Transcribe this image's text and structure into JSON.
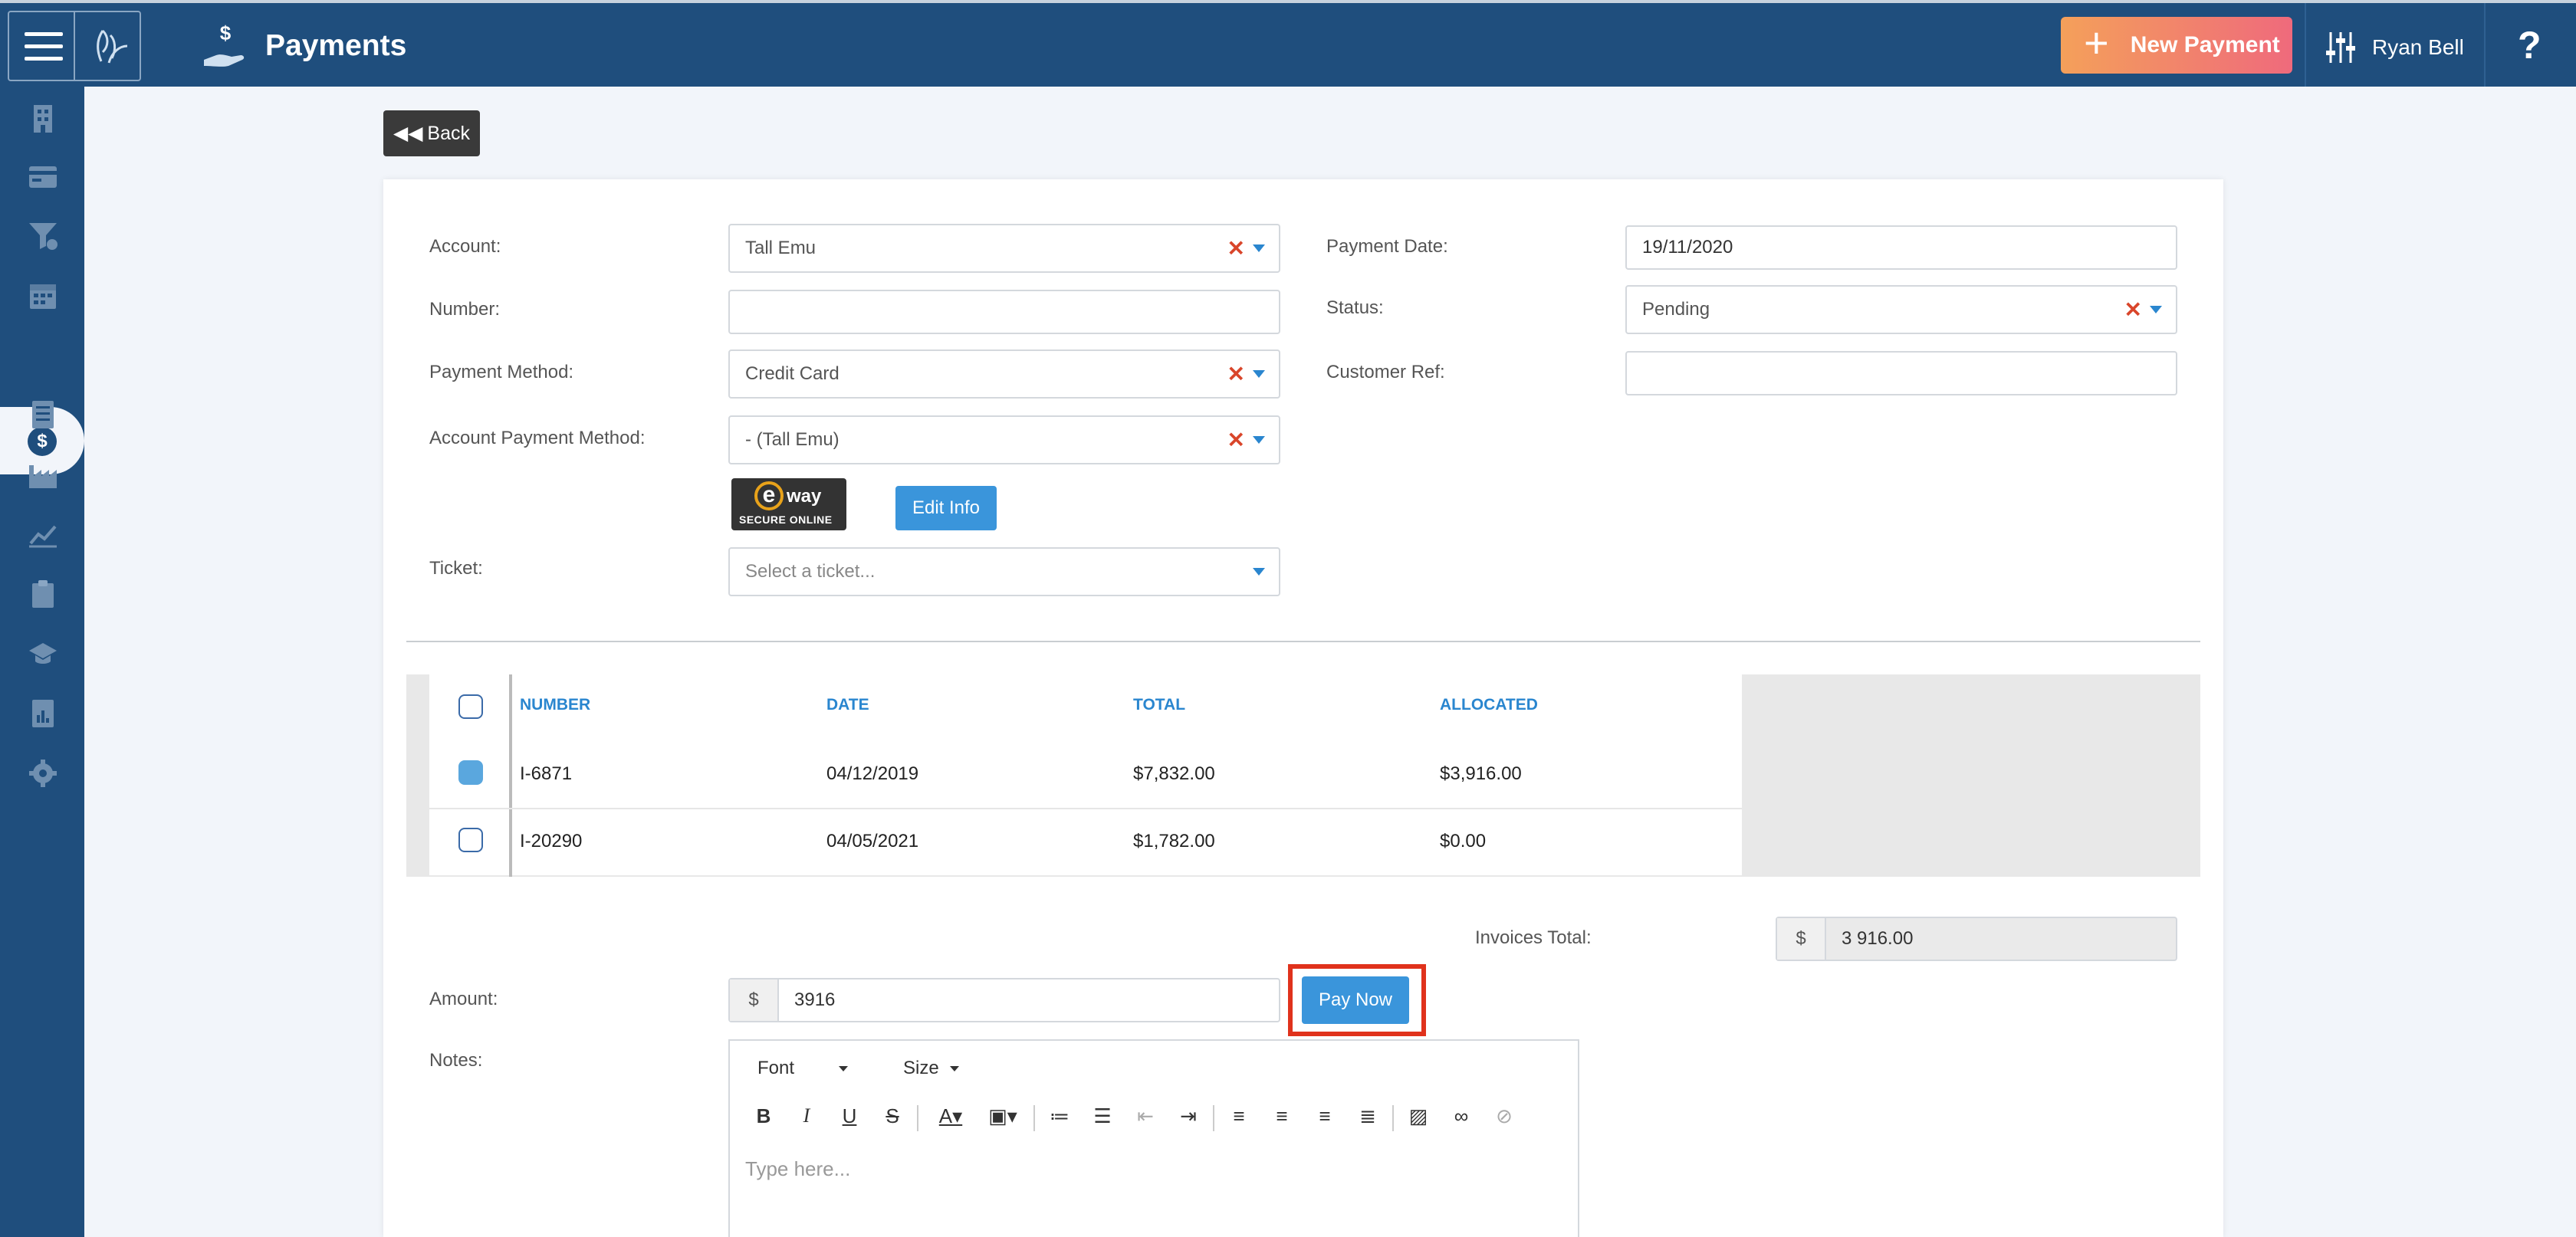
{
  "topbar": {
    "title": "Payments",
    "new_payment_label": "New Payment",
    "user_name": "Ryan Bell",
    "help_label": "?"
  },
  "sidebar": {
    "icons": [
      "building-icon",
      "card-icon",
      "funnel-icon",
      "calendar-icon",
      "dollar-icon",
      "list-icon",
      "factory-icon",
      "trend-icon",
      "clipboard-icon",
      "graduation-icon",
      "report-icon",
      "gear-icon"
    ],
    "active_label": "$"
  },
  "back_label": "Back",
  "form": {
    "account_label": "Account:",
    "account_value": "Tall Emu",
    "number_label": "Number:",
    "number_value": "",
    "payment_method_label": "Payment Method:",
    "payment_method_value": "Credit Card",
    "account_payment_method_label": "Account Payment Method:",
    "account_payment_method_value": "- (Tall Emu)",
    "eway_logo_text": "way",
    "eway_secure_text": "SECURE ONLINE",
    "edit_info_label": "Edit Info",
    "ticket_label": "Ticket:",
    "ticket_placeholder": "Select a ticket...",
    "payment_date_label": "Payment Date:",
    "payment_date_value": "19/11/2020",
    "status_label": "Status:",
    "status_value": "Pending",
    "customer_ref_label": "Customer Ref:",
    "customer_ref_value": ""
  },
  "invoices": {
    "headers": [
      "NUMBER",
      "DATE",
      "TOTAL",
      "ALLOCATED"
    ],
    "rows": [
      {
        "number": "I-6871",
        "date": "04/12/2019",
        "total": "$7,832.00",
        "allocated": "$3,916.00",
        "checked": true
      },
      {
        "number": "I-20290",
        "date": "04/05/2021",
        "total": "$1,782.00",
        "allocated": "$0.00",
        "checked": false
      }
    ]
  },
  "totals": {
    "invoices_total_label": "Invoices Total:",
    "currency": "$",
    "invoices_total_value": "3 916.00",
    "amount_label": "Amount:",
    "amount_value": "3916",
    "pay_now_label": "Pay Now"
  },
  "notes": {
    "label": "Notes:",
    "font_label": "Font",
    "size_label": "Size",
    "placeholder": "Type here..."
  },
  "colors": {
    "brand": "#1f4e7d",
    "accent": "#3a95db",
    "highlight": "#e0321c"
  }
}
